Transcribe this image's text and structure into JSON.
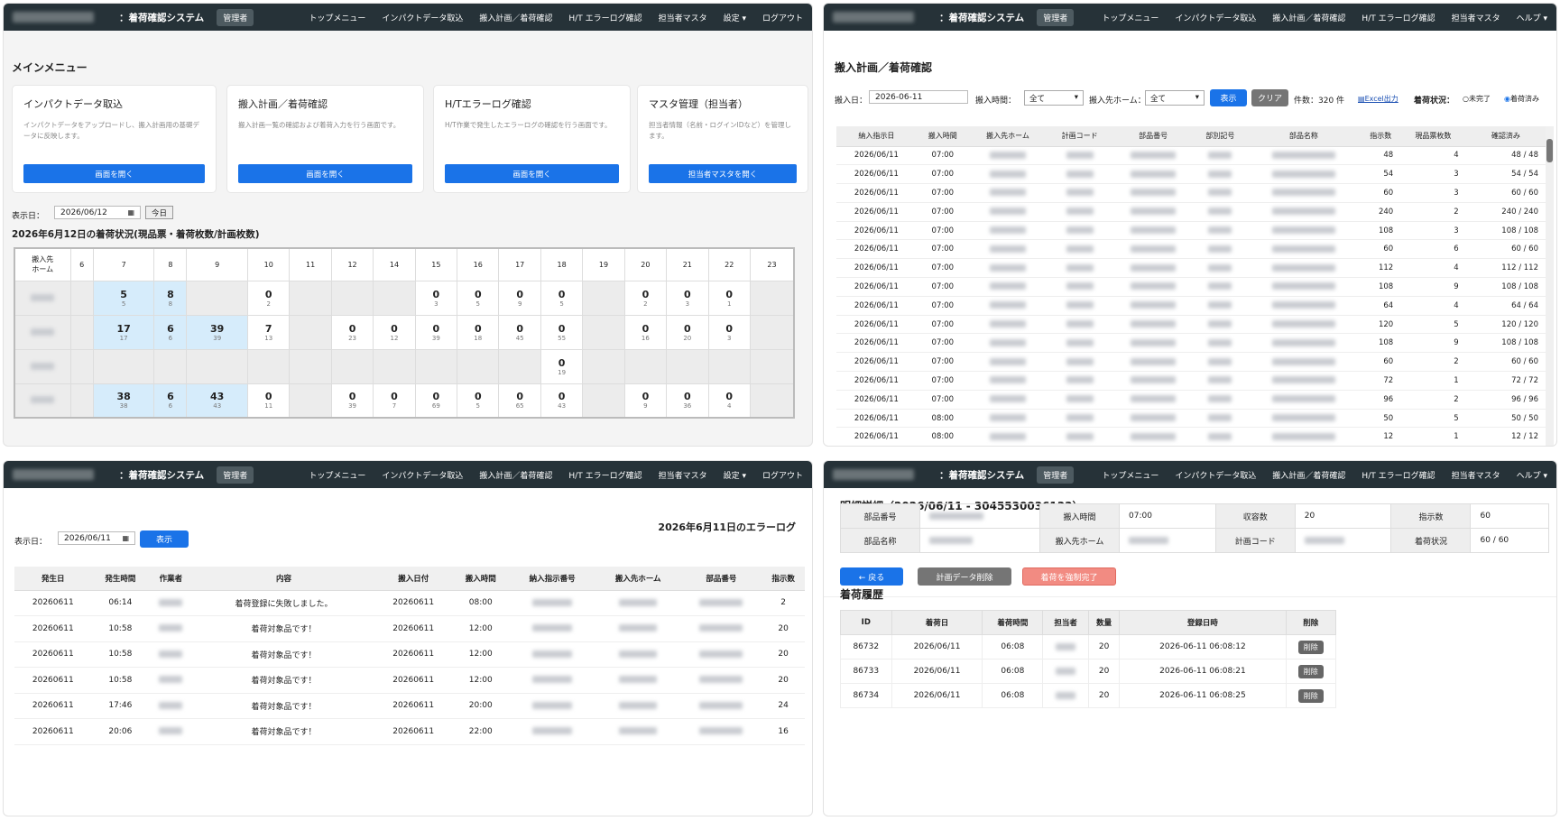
{
  "nav": {
    "system": "：着荷確認システム",
    "role": "管理者",
    "links": [
      "トップメニュー",
      "インパクトデータ取込",
      "搬入計画／着荷確認",
      "H/T エラーログ確認",
      "担当者マスタ",
      "設定 ▾",
      "ログアウト"
    ],
    "links2": [
      "トップメニュー",
      "インパクトデータ取込",
      "搬入計画／着荷確認",
      "H/T エラーログ確認",
      "担当者マスタ",
      "ヘルプ ▾"
    ]
  },
  "menu": {
    "title": "メインメニュー",
    "cards": [
      {
        "title": "インパクトデータ取込",
        "desc": "インパクトデータをアップロードし、搬入計画用の基礎データに反映します。",
        "btn": "画面を開く"
      },
      {
        "title": "搬入計画／着荷確認",
        "desc": "搬入計画一覧の確認および着荷入力を行う画面です。",
        "btn": "画面を開く"
      },
      {
        "title": "H/Tエラーログ確認",
        "desc": "H/T作業で発生したエラーログの確認を行う画面です。",
        "btn": "画面を開く"
      },
      {
        "title": "マスタ管理（担当者）",
        "desc": "担当者情報（名前・ログインIDなど）を管理します。",
        "btn": "担当者マスタを開く"
      }
    ],
    "date_label": "表示日：",
    "date": "2026/06/12",
    "today": "今日",
    "status_title": "2026年6月12日の着荷状況(現品票・着荷枚数/計画枚数)",
    "hours": [
      "6",
      "7",
      "8",
      "9",
      "10",
      "11",
      "12",
      "14",
      "15",
      "16",
      "17",
      "18",
      "19",
      "20",
      "21",
      "22",
      "23"
    ],
    "row_header": "搬入先\nホーム"
  },
  "plan": {
    "title": "搬入計画／着荷確認",
    "date_label": "搬入日：",
    "date": "2026-06-11",
    "time_label": "搬入時間：",
    "time": "全て",
    "home_label": "搬入先ホーム：",
    "home": "全て",
    "show": "表示",
    "clear": "クリア",
    "count": "件数：320 件",
    "excel": "Excel出力",
    "status_label": "着荷状況：",
    "opt1": "未完了",
    "opt2": "着荷済み",
    "cols": [
      "納入指示日",
      "搬入時間",
      "搬入先ホーム",
      "計画コード",
      "部品番号",
      "部別記号",
      "部品名称",
      "指示数",
      "現品票枚数",
      "確認済み"
    ],
    "rows": [
      [
        "2026/06/11",
        "07:00",
        "48",
        "4",
        "48",
        "48"
      ],
      [
        "2026/06/11",
        "07:00",
        "54",
        "3",
        "54",
        "54"
      ],
      [
        "2026/06/11",
        "07:00",
        "60",
        "3",
        "60",
        "60"
      ],
      [
        "2026/06/11",
        "07:00",
        "240",
        "2",
        "240",
        "240"
      ],
      [
        "2026/06/11",
        "07:00",
        "108",
        "3",
        "108",
        "108"
      ],
      [
        "2026/06/11",
        "07:00",
        "60",
        "6",
        "60",
        "60"
      ],
      [
        "2026/06/11",
        "07:00",
        "112",
        "4",
        "112",
        "112"
      ],
      [
        "2026/06/11",
        "07:00",
        "108",
        "9",
        "108",
        "108"
      ],
      [
        "2026/06/11",
        "07:00",
        "64",
        "4",
        "64",
        "64"
      ],
      [
        "2026/06/11",
        "07:00",
        "120",
        "5",
        "120",
        "120"
      ],
      [
        "2026/06/11",
        "07:00",
        "108",
        "9",
        "108",
        "108"
      ],
      [
        "2026/06/11",
        "07:00",
        "60",
        "2",
        "60",
        "60"
      ],
      [
        "2026/06/11",
        "07:00",
        "72",
        "1",
        "72",
        "72"
      ],
      [
        "2026/06/11",
        "07:00",
        "96",
        "2",
        "96",
        "96"
      ],
      [
        "2026/06/11",
        "08:00",
        "50",
        "5",
        "50",
        "50"
      ],
      [
        "2026/06/11",
        "08:00",
        "12",
        "1",
        "12",
        "12"
      ]
    ]
  },
  "errlog": {
    "title": "2026年6月11日のエラーログ",
    "date_label": "表示日：",
    "date": "2026/06/11",
    "show": "表示",
    "cols": [
      "発生日",
      "発生時間",
      "作業者",
      "内容",
      "搬入日付",
      "搬入時間",
      "納入指示番号",
      "搬入先ホーム",
      "部品番号",
      "指示数"
    ],
    "rows": [
      [
        "20260611",
        "06:14",
        "着荷登録に失敗しました。",
        "20260611",
        "08:00",
        "2"
      ],
      [
        "20260611",
        "10:58",
        "着荷対象品です！",
        "20260611",
        "12:00",
        "20"
      ],
      [
        "20260611",
        "10:58",
        "着荷対象品です！",
        "20260611",
        "12:00",
        "20"
      ],
      [
        "20260611",
        "10:58",
        "着荷対象品です！",
        "20260611",
        "12:00",
        "20"
      ],
      [
        "20260611",
        "17:46",
        "着荷対象品です！",
        "20260611",
        "20:00",
        "24"
      ],
      [
        "20260611",
        "20:06",
        "着荷対象品です！",
        "20260611",
        "22:00",
        "16"
      ]
    ]
  },
  "detail": {
    "title": "明細詳細（2026/06/11 - 3045530036133）",
    "k1": "部品番号",
    "k2": "搬入時間",
    "v2": "07:00",
    "k3": "収容数",
    "v3": "20",
    "k4": "指示数",
    "v4": "60",
    "k5": "部品名称",
    "k6": "搬入先ホーム",
    "k7": "計画コード",
    "k8": "着荷状況",
    "v8": "60 / 60",
    "back": "← 戻る",
    "delplan": "計画データ削除",
    "force": "着荷を強制完了",
    "hist_title": "着荷履歴",
    "hcols": [
      "ID",
      "着荷日",
      "着荷時間",
      "担当者",
      "数量",
      "登録日時",
      "削除"
    ],
    "hrows": [
      [
        "86732",
        "2026/06/11",
        "06:08",
        "20",
        "2026-06-11 06:08:12"
      ],
      [
        "86733",
        "2026/06/11",
        "06:08",
        "20",
        "2026-06-11 06:08:21"
      ],
      [
        "86734",
        "2026/06/11",
        "06:08",
        "20",
        "2026-06-11 06:08:25"
      ]
    ],
    "del": "削除"
  },
  "colors": {
    "nav": "#263238",
    "primary": "#1a73e8",
    "danger": "#f28b82",
    "gray": "#757575",
    "cell_highlight": "#d6ecfb"
  }
}
